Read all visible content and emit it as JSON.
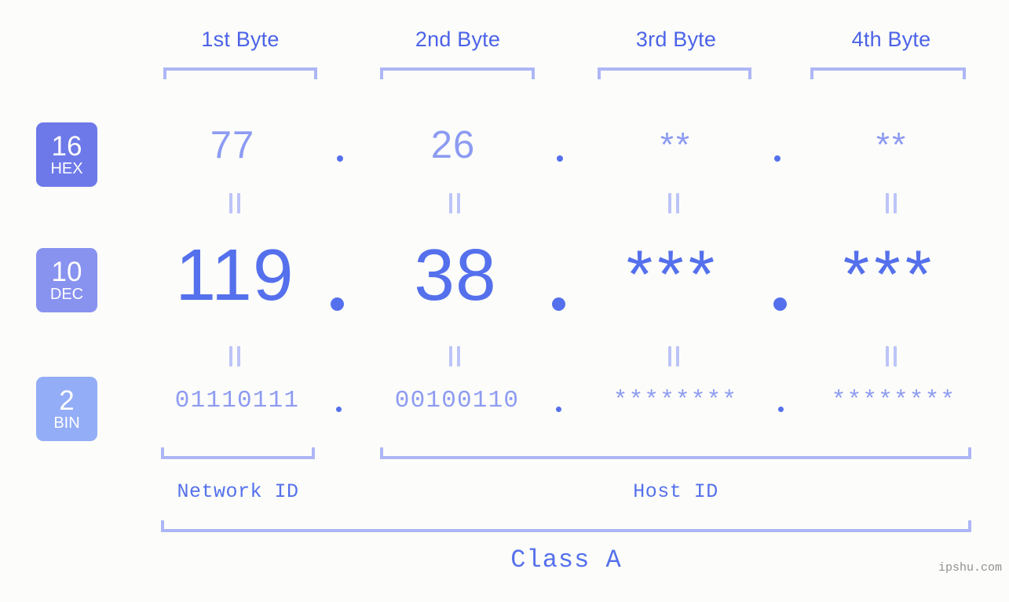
{
  "background_color": "#fcfdfa",
  "accent_strong": "#5570ec",
  "accent_mid": "#8d9bf2",
  "accent_light": "#adb6f5",
  "byte_headers": [
    {
      "label": "1st Byte"
    },
    {
      "label": "2nd Byte"
    },
    {
      "label": "3rd Byte"
    },
    {
      "label": "4th Byte"
    }
  ],
  "rows": {
    "hex": {
      "badge_number": "16",
      "badge_unit": "HEX",
      "badge_color": "#6d79e8",
      "values": [
        "77",
        "26",
        "**",
        "**"
      ]
    },
    "dec": {
      "badge_number": "10",
      "badge_unit": "DEC",
      "badge_color": "#8892ef",
      "values": [
        "119",
        "38",
        "***",
        "***"
      ]
    },
    "bin": {
      "badge_number": "2",
      "badge_unit": "BIN",
      "badge_color": "#93adf7",
      "values": [
        "01110111",
        "00100110",
        "********",
        "********"
      ]
    }
  },
  "separators": {
    "dot": ".",
    "equals": "="
  },
  "footer": {
    "network_id_label": "Network ID",
    "host_id_label": "Host ID",
    "class_label": "Class A",
    "watermark": "ipshu.com"
  }
}
